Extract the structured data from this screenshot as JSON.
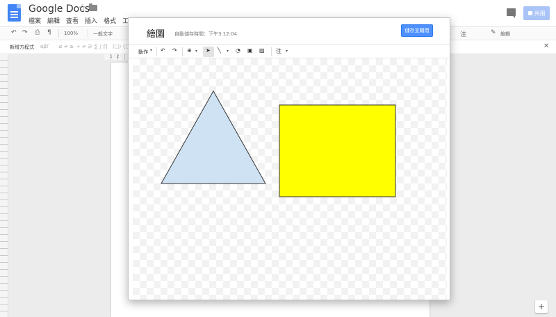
{
  "header": {
    "doc_title": "Google Docs",
    "menu": [
      "檔案",
      "編輯",
      "查看",
      "插入",
      "格式",
      "工具"
    ],
    "share_label": "共用"
  },
  "toolbar": {
    "zoom": "100%",
    "style": "一般文字",
    "notes": "注",
    "edit_mode": "編輯"
  },
  "equation_bar": {
    "label": "新增方程式",
    "symbols": [
      "αβΓ",
      "≤ ≠ ≥",
      "÷ ≠ ∋",
      "∑ ∫ ∏",
      "(□) {□}"
    ]
  },
  "ruler": {
    "top_numbers": "1 · 2 ·"
  },
  "drawing_dialog": {
    "title": "繪圖",
    "autosave": "自動儲存時間：下午3:12:04",
    "save_button": "儲存並關閉",
    "toolbar": {
      "actions": "動作",
      "notes": "注"
    },
    "shapes": [
      {
        "type": "triangle",
        "fill": "#cfe2f3",
        "stroke": "#333333"
      },
      {
        "type": "rectangle",
        "fill": "#ffff00",
        "stroke": "#333333"
      }
    ]
  }
}
